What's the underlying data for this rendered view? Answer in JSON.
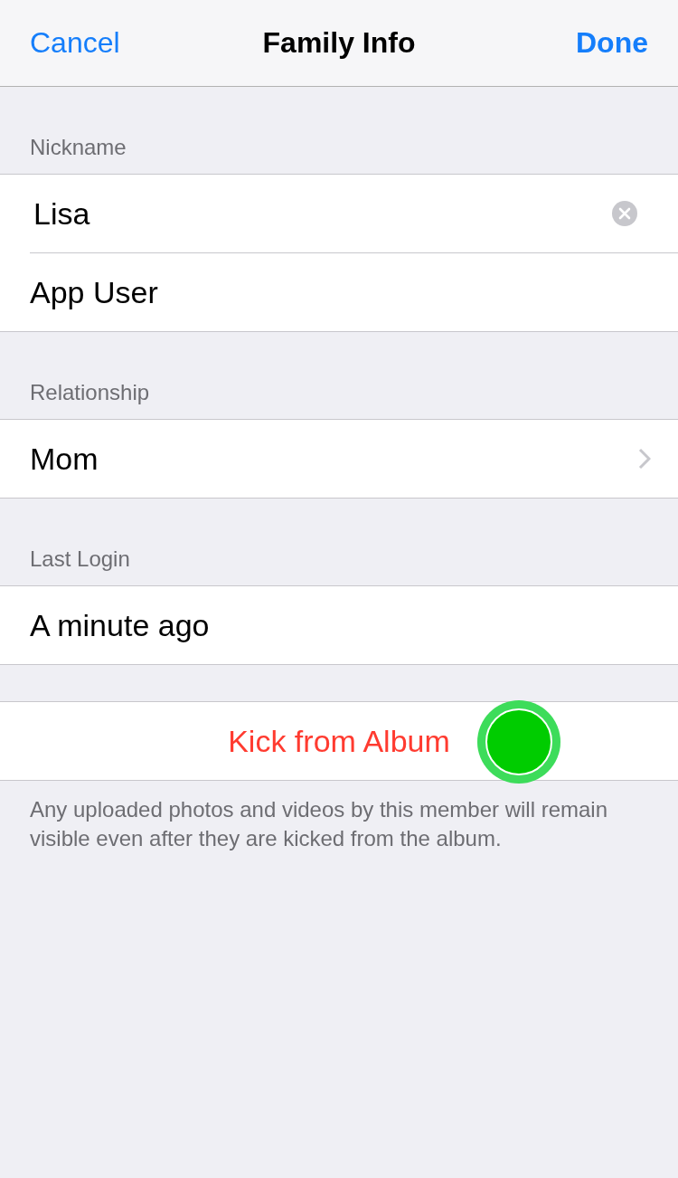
{
  "nav_bar": {
    "cancel": "Cancel",
    "title": "Family Info",
    "done": "Done"
  },
  "sections": [
    {
      "header": "Nickname",
      "rows": [
        {
          "kind": "field",
          "value": "Lisa"
        },
        {
          "kind": "text",
          "text": "App User"
        }
      ]
    },
    {
      "header": "Relationship",
      "rows": [
        {
          "kind": "link",
          "text": "Mom"
        }
      ]
    },
    {
      "header": "Last Login",
      "rows": [
        {
          "kind": "text",
          "text": "A minute ago"
        }
      ]
    }
  ],
  "kick_button": "Kick from Album",
  "footnote": "Any uploaded photos and videos by this member will remain visible even after they are kicked from the album."
}
